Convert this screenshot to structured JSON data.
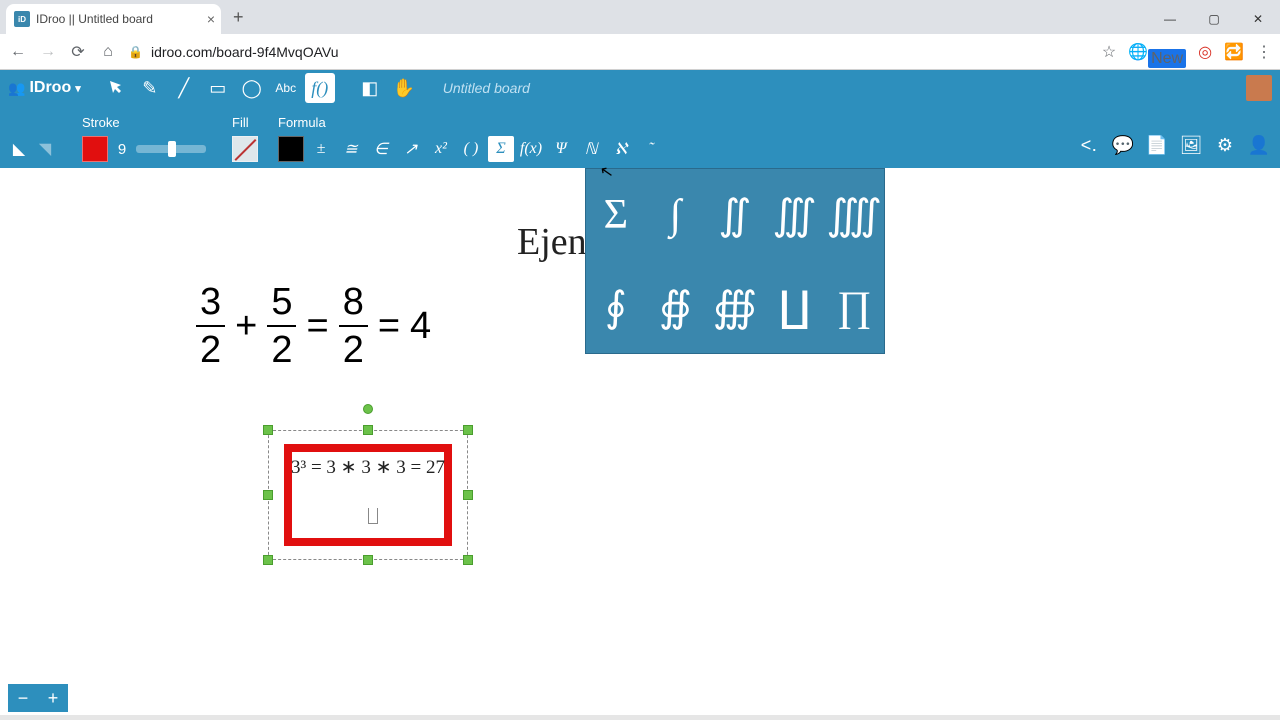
{
  "browser": {
    "tab_title": "IDroo || Untitled board",
    "url": "idroo.com/board-9f4MvqOAVu"
  },
  "app": {
    "logo_text": "IDroo",
    "board_title": "Untitled board",
    "tools": {
      "pointer": "pointer",
      "pen": "pen",
      "line": "line",
      "rect": "rect",
      "ellipse": "ellipse",
      "text": "Abc",
      "formula": "f()",
      "eraser": "eraser",
      "pan": "pan"
    }
  },
  "sub": {
    "stroke_label": "Stroke",
    "fill_label": "Fill",
    "formula_label": "Formula",
    "stroke_color": "#e10f0f",
    "stroke_width": "9",
    "fill_color": "#000000",
    "formula_buttons": [
      "±",
      "≅",
      "∈",
      "↗",
      "x²",
      "( )",
      "Σ",
      "f(x)",
      "Ψ",
      "ℕ",
      "ℵ",
      "˜"
    ]
  },
  "canvas": {
    "heading": "Ejen",
    "equation1": {
      "f1n": "3",
      "f1d": "2",
      "f2n": "5",
      "f2d": "2",
      "f3n": "8",
      "f3d": "2",
      "rhs": "4"
    },
    "box_expr": "3³ = 3 ∗ 3 ∗ 3 = 27"
  },
  "palette": {
    "items": [
      "Σ",
      "∫",
      "∬",
      "∭",
      "⨌",
      "∮",
      "∯",
      "∰",
      "∐",
      "∏"
    ]
  },
  "zoom": {
    "out": "−",
    "in": "+"
  }
}
